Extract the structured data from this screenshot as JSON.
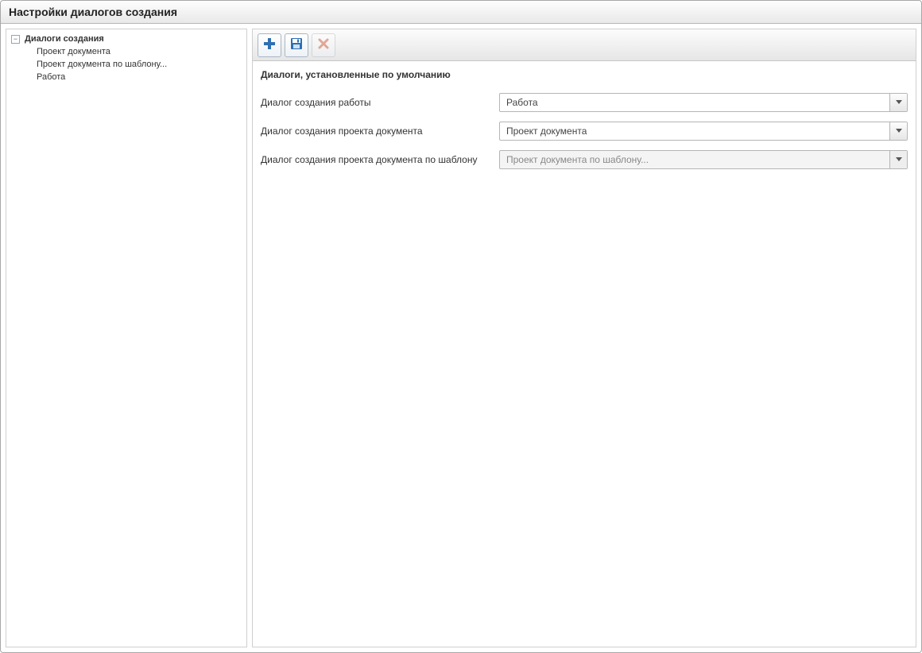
{
  "window": {
    "title": "Настройки диалогов создания"
  },
  "sidebar": {
    "root_label": "Диалоги создания",
    "toggle_glyph": "−",
    "items": [
      {
        "label": "Проект документа"
      },
      {
        "label": "Проект документа по шаблону..."
      },
      {
        "label": "Работа"
      }
    ]
  },
  "toolbar": {
    "add_icon": "plus-icon",
    "save_icon": "save-icon",
    "delete_icon": "delete-icon"
  },
  "section": {
    "title": "Диалоги, установленные по умолчанию"
  },
  "form": {
    "rows": [
      {
        "label": "Диалог создания работы",
        "value": "Работа",
        "disabled": false
      },
      {
        "label": "Диалог создания проекта документа",
        "value": "Проект документа",
        "disabled": false
      },
      {
        "label": "Диалог создания проекта документа по шаблону",
        "value": "Проект документа по шаблону...",
        "disabled": true
      }
    ]
  }
}
